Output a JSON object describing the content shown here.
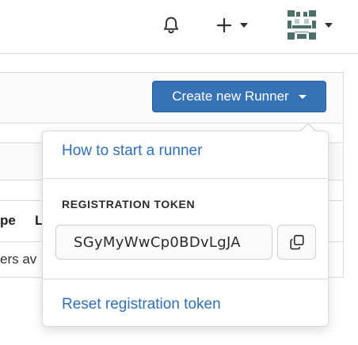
{
  "topbar": {
    "icons": {
      "notifications": "bell-icon",
      "new_item": "plus-icon",
      "user": "avatar-identicon"
    }
  },
  "background_table": {
    "type_header_fragment": "pe",
    "last_header_fragment": "L",
    "empty_text_fragment": "ers av"
  },
  "create_runner": {
    "label": "Create new Runner",
    "color": "#3572b6"
  },
  "dropdown": {
    "how_to_start": "How to start a runner",
    "token_heading": "REGISTRATION TOKEN",
    "token_value": "SGyMyWwCp0BDvLgJA",
    "copy_icon": "copy-icon",
    "reset_token": "Reset registration token",
    "link_color": "#2f6fb7"
  }
}
